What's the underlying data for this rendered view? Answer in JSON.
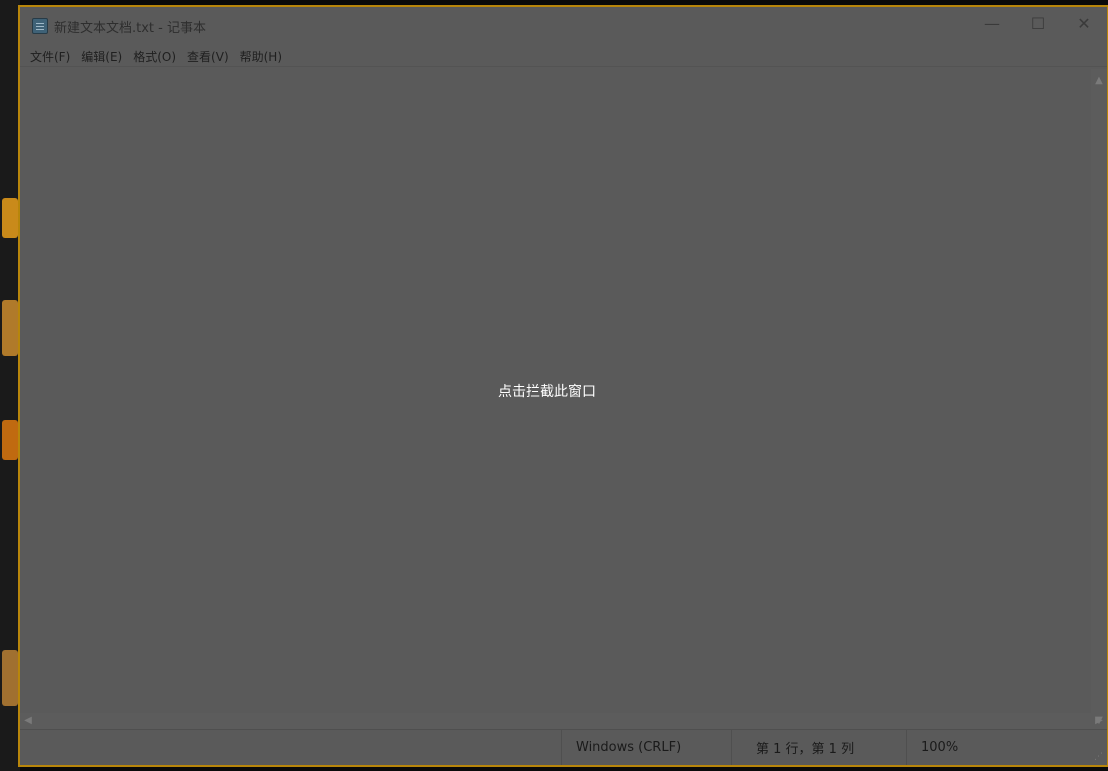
{
  "window": {
    "title": "新建文本文档.txt - 记事本",
    "controls": {
      "minimize": "—",
      "maximize": "☐",
      "close": "✕"
    }
  },
  "menu": {
    "items": [
      "文件(F)",
      "编辑(E)",
      "格式(O)",
      "查看(V)",
      "帮助(H)"
    ]
  },
  "overlay": {
    "text": "点击拦截此窗口"
  },
  "status": {
    "encoding": "Windows (CRLF)",
    "position": "第 1 行，第 1 列",
    "zoom": "100%"
  },
  "colors": {
    "frame_border": "#b8860b",
    "window_bg": "#5a5a5a",
    "overlay_text": "#ffffff"
  },
  "icons": [
    "notepad-app-icon",
    "minimize-icon",
    "maximize-icon",
    "close-icon",
    "scroll-up-icon",
    "scroll-down-icon",
    "scroll-left-icon",
    "scroll-right-icon",
    "resize-grip-icon"
  ]
}
